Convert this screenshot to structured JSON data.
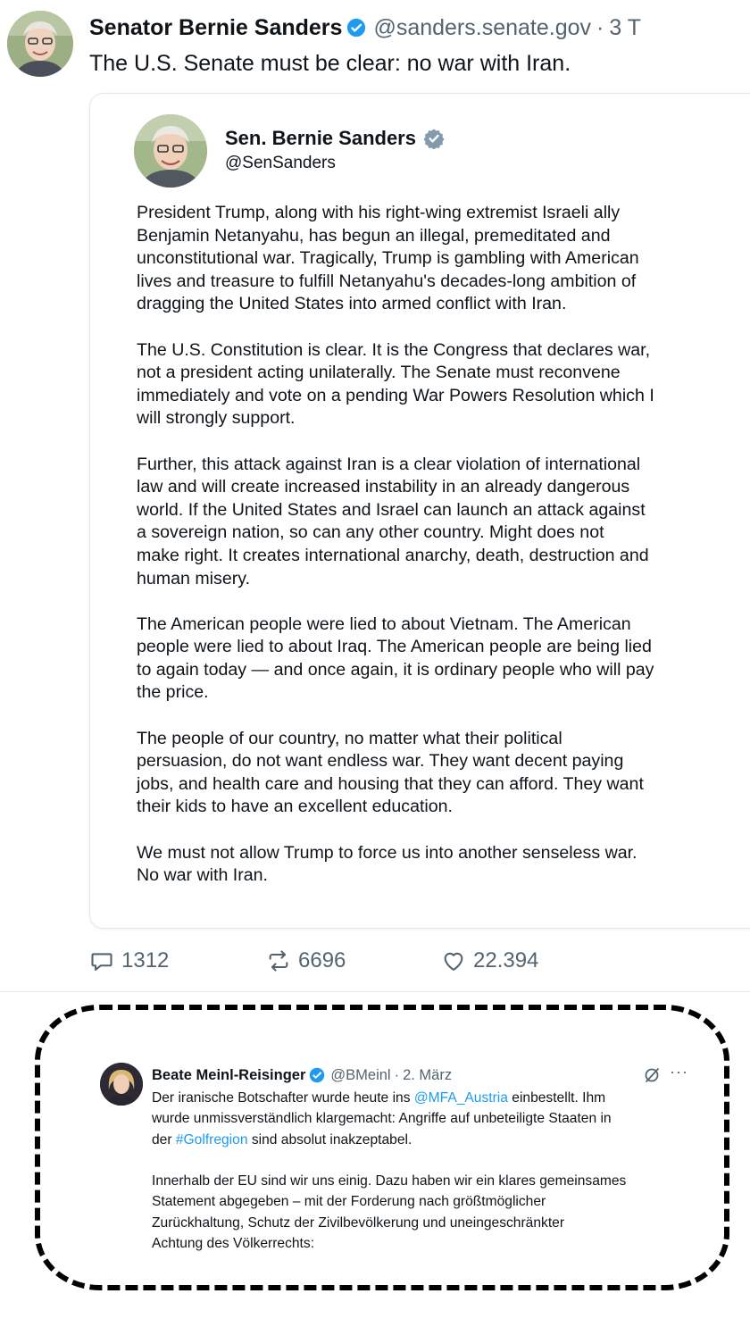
{
  "main_post": {
    "author_name": "Senator Bernie Sanders",
    "handle": "@sanders.senate.gov",
    "separator": "·",
    "time": "3 T",
    "text": "The U.S. Senate must be clear: no war with Iran."
  },
  "quoted_post": {
    "author_name": "Sen. Bernie Sanders",
    "handle": "@SenSanders",
    "paragraphs": [
      [
        "President Trump, along with his right-wing extremist Israeli ally",
        "Benjamin Netanyahu, has begun an illegal, premeditated and",
        "unconstitutional war. Tragically, Trump is gambling with American",
        "lives and treasure to fulfill Netanyahu's decades-long ambition of",
        "dragging the United States into armed conflict with Iran."
      ],
      [
        "The U.S. Constitution is clear. It is the Congress that declares war,",
        "not a president acting unilaterally. The Senate must reconvene",
        "immediately and vote on a pending War Powers Resolution which I",
        "will strongly support."
      ],
      [
        "Further, this attack against Iran is a clear violation of international",
        "law and will create increased instability in an already dangerous",
        "world. If the United States and Israel can launch an attack against",
        "a sovereign nation, so can any other country. Might does not",
        "make right. It creates international anarchy, death, destruction and",
        "human misery."
      ],
      [
        "The American people were lied to about Vietnam. The American",
        "people were lied to about Iraq. The American people are being lied",
        "to again today — and once again, it is ordinary people who will pay",
        "the price."
      ],
      [
        "The people of our country, no matter what their political",
        "persuasion, do not want endless war. They want decent paying",
        "jobs, and health care and housing that they can afford. They want",
        "their kids to have an excellent education."
      ],
      [
        "We must not allow Trump to force us into another senseless war.",
        "No war with Iran."
      ]
    ]
  },
  "actions": {
    "replies": "1312",
    "reposts": "6696",
    "likes": "22.394"
  },
  "embedded_post": {
    "author_name": "Beate Meinl-Reisinger",
    "handle": "@BMeinl",
    "separator": "·",
    "date": "2. März",
    "more": "···",
    "line1_pre": "Der iranische Botschafter wurde heute ins ",
    "line1_link": "@MFA_Austria",
    "line1_post": "  einbestellt. Ihm",
    "line2": "wurde unmissverständlich klargemacht: Angriffe auf unbeteiligte Staaten in",
    "line3_pre": "der ",
    "line3_link": "#Golfregion",
    "line3_post": " sind absolut inakzeptabel.",
    "paragraph2": [
      "Innerhalb der EU sind wir uns einig. Dazu haben wir ein klares gemeinsames",
      "Statement abgegeben – mit der Forderung nach größtmöglicher",
      "Zurückhaltung, Schutz der Zivilbevölkerung und uneingeschränkter",
      "Achtung des Völkerrechts:"
    ]
  },
  "colors": {
    "verified_blue": "#1d9bf0",
    "verified_gray": "#829aab",
    "link": "#1d9bf0",
    "secondary_text": "#536471"
  }
}
